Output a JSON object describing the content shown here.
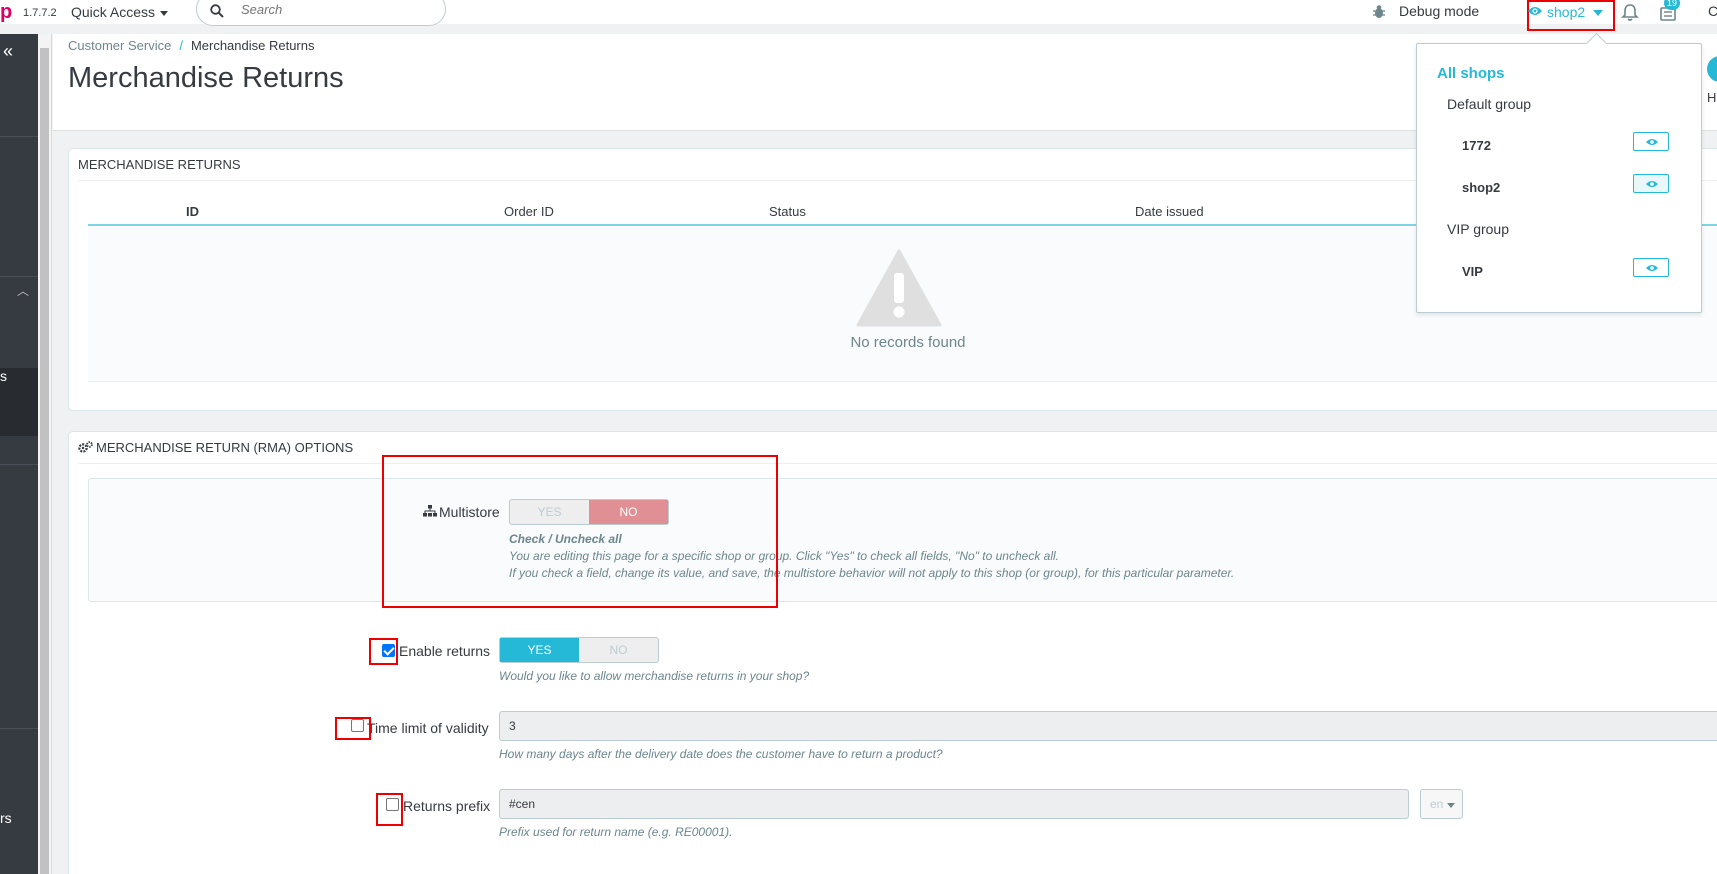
{
  "header": {
    "logo_letter": "p",
    "version": "1.7.7.2",
    "quick_access": "Quick Access",
    "search_placeholder": "Search",
    "debug_mode": "Debug mode",
    "shop_name": "shop2",
    "orders_badge": "19",
    "edge_letter": "C"
  },
  "sidebar": {
    "frag_1": "s",
    "frag_2": "rs"
  },
  "breadcrumb": {
    "parent": "Customer Service",
    "separator": "/",
    "current": "Merchandise Returns"
  },
  "page": {
    "title": "Merchandise Returns",
    "help_label": "H"
  },
  "returns_panel": {
    "heading": "MERCHANDISE RETURNS",
    "columns": [
      "ID",
      "Order ID",
      "Status",
      "Date issued"
    ],
    "empty_text": "No records found"
  },
  "options_panel": {
    "heading": "MERCHANDISE RETURN (RMA) OPTIONS",
    "multistore": {
      "label": "Multistore",
      "yes": "YES",
      "no": "NO",
      "selected": "NO",
      "help_title": "Check / Uncheck all",
      "help_line1": "You are editing this page for a specific shop or group. Click \"Yes\" to check all fields, \"No\" to uncheck all.",
      "help_line2": "If you check a field, change its value, and save, the multistore behavior will not apply to this shop (or group), for this particular parameter."
    },
    "enable_returns": {
      "label": "Enable returns",
      "yes": "YES",
      "no": "NO",
      "selected": "YES",
      "checked": true,
      "help": "Would you like to allow merchandise returns in your shop?"
    },
    "time_limit": {
      "label": "Time limit of validity",
      "value": "3",
      "checked": false,
      "help": "How many days after the delivery date does the customer have to return a product?"
    },
    "returns_prefix": {
      "label": "Returns prefix",
      "value": "#cen",
      "lang": "en",
      "checked": false,
      "help": "Prefix used for return name (e.g. RE00001)."
    }
  },
  "shop_dropdown": {
    "all_shops": "All shops",
    "groups": [
      {
        "name": "Default group",
        "shops": [
          "1772",
          "shop2"
        ]
      },
      {
        "name": "VIP group",
        "shops": [
          "VIP"
        ]
      }
    ]
  },
  "colors": {
    "accent": "#25b9d7",
    "brand": "#df0067",
    "sidebar": "#363a41",
    "no_active": "#e08f95",
    "highlight_box": "#ee0000"
  }
}
